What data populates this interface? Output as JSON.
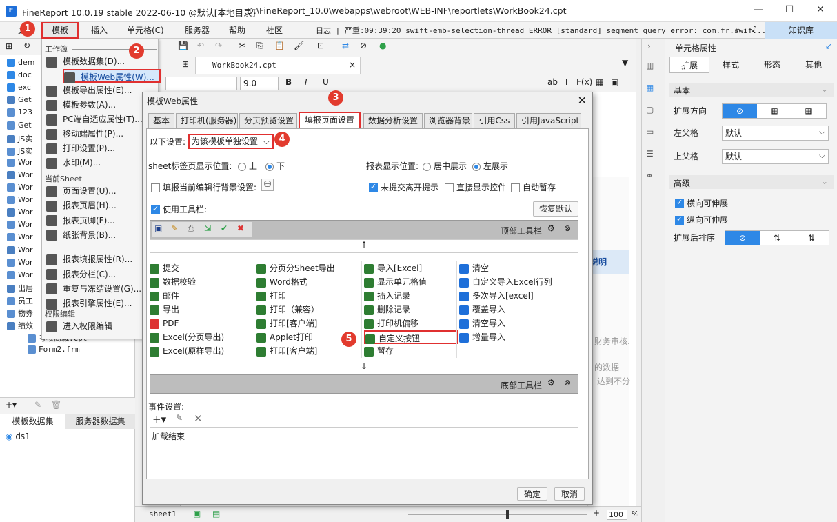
{
  "app": {
    "title": "FineReport 10.0.19 stable 2022-06-10 @默认[本地目录]",
    "path": "D:\\FineReport_10.0\\webapps\\webroot\\WEB-INF\\reportlets\\WorkBook24.cpt",
    "logo": "F"
  },
  "menubar": {
    "file": "文",
    "items": [
      "模板",
      "插入",
      "单元格(C)",
      "服务器",
      "帮助",
      "社区"
    ],
    "log_label": "日志",
    "log_text": "严重:09:39:20 swift-emb-selection-thread ERROR [standard] segment query error: com.fr.swif...",
    "kb": "知识库"
  },
  "badges": [
    "1",
    "2",
    "3",
    "4",
    "5"
  ],
  "left_tree": {
    "items": [
      "dem",
      "doc",
      "exc",
      "Get",
      "123",
      "Get",
      "JS实",
      "JS实",
      "Wor",
      "Wor",
      "Wor",
      "Wor",
      "Wor",
      "Wor",
      "Wor",
      "Wor",
      "Wor",
      "Wor",
      "出居",
      "员工",
      "物券",
      "绩效",
      "考核商城.cpt",
      "Form2.frm"
    ],
    "tabs": [
      "模板数据集",
      "服务器数据集"
    ],
    "ds": "ds1"
  },
  "template_menu": {
    "section_workbook": "工作簿",
    "workbook_items": [
      "模板数据集(D)...",
      "模板Web属性(W)...",
      "模板导出属性(E)...",
      "模板参数(A)...",
      "PC端自适应属性(T)...",
      "移动端属性(P)...",
      "打印设置(P)...",
      "水印(M)..."
    ],
    "section_sheet": "当前Sheet",
    "sheet_items": [
      "页面设置(U)...",
      "报表页眉(H)...",
      "报表页脚(F)...",
      "纸张背景(B)...",
      "报表填报属性(R)...",
      "报表分栏(C)...",
      "重复与冻结设置(G)...",
      "报表引擎属性(E)..."
    ],
    "section_perm": "权限编辑",
    "perm_items": [
      "进入权限编辑"
    ]
  },
  "editor": {
    "file_tab": "WorkBook24.cpt",
    "font_size": "9.0",
    "sheet_tab": "sheet1",
    "zoom": "100",
    "zoom_unit": "%",
    "bg_texts": [
      "说明",
      "财务审核.",
      "的数据",
      "达到不分"
    ]
  },
  "right_panel": {
    "title": "单元格属性",
    "tabs": [
      "扩展",
      "样式",
      "形态",
      "其他"
    ],
    "basic": "基本",
    "expand_dir_label": "扩展方向",
    "left_parent_label": "左父格",
    "left_parent_value": "默认",
    "top_parent_label": "上父格",
    "top_parent_value": "默认",
    "advanced": "高级",
    "horizontal_expand": "横向可伸展",
    "vertical_expand": "纵向可伸展",
    "sort_label": "扩展后排序"
  },
  "dialog": {
    "title": "模板Web属性",
    "tabs": [
      "基本",
      "打印机(服务器)",
      "分页预览设置",
      "填报页面设置",
      "数据分析设置",
      "浏览器背景",
      "引用Css",
      "引用JavaScript"
    ],
    "setting_label": "以下设置:",
    "setting_value": "为该模板单独设置",
    "sheet_pos_label": "sheet标签页显示位置:",
    "sheet_pos_options": [
      "上",
      "下"
    ],
    "report_pos_label": "报表显示位置:",
    "report_pos_options": [
      "居中展示",
      "左展示"
    ],
    "fill_bg_label": "填报当前编辑行背景设置:",
    "unsubmitted_label": "未提交离开提示",
    "direct_ctrl_label": "直接显示控件",
    "auto_save_label": "自动暂存",
    "use_toolbar_label": "使用工具栏:",
    "restore_default": "恢复默认",
    "top_toolbar": "顶部工具栏",
    "bottom_toolbar": "底部工具栏",
    "buttons": [
      [
        "提交",
        "分页分Sheet导出",
        "导入[Excel]",
        "清空"
      ],
      [
        "数据校验",
        "Word格式",
        "显示单元格值",
        "自定义导入Excel行列"
      ],
      [
        "邮件",
        "打印",
        "插入记录",
        "多次导入[excel]"
      ],
      [
        "导出",
        "打印（兼容）",
        "删除记录",
        "覆盖导入"
      ],
      [
        "PDF",
        "打印[客户端]",
        "打印机偏移",
        "清空导入"
      ],
      [
        "Excel(分页导出)",
        "Applet打印",
        "自定义按钮",
        "增量导入"
      ],
      [
        "Excel(原样导出)",
        "打印[客户端]",
        "暂存",
        ""
      ]
    ],
    "event_label": "事件设置:",
    "event_item": "加载结束",
    "ok": "确定",
    "cancel": "取消"
  }
}
